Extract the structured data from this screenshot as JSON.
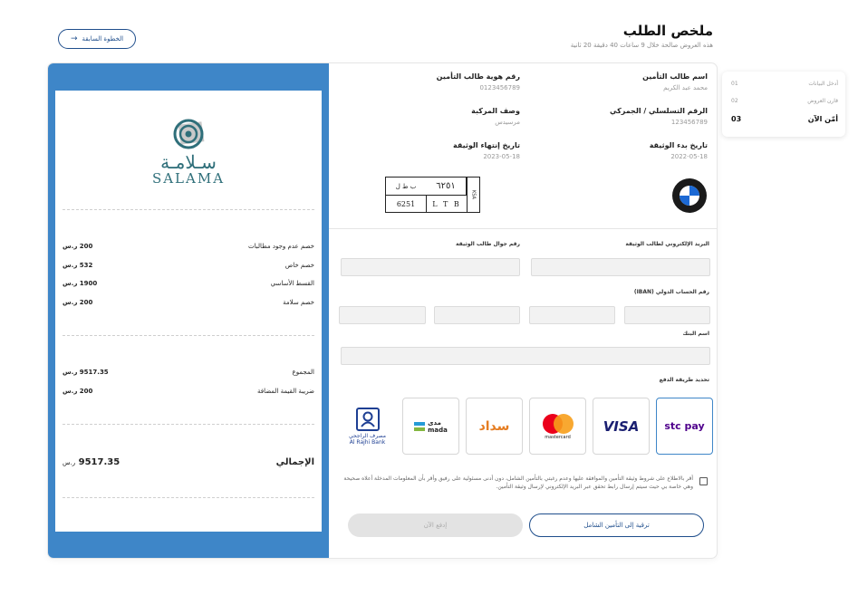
{
  "header": {
    "title": "ملخص الطلب",
    "subtitle": "هذه العروض صالحة خلال 9 ساعات 40 دقيقة 20 ثانية",
    "back_label": "الخطوة السابقة"
  },
  "steps": [
    {
      "num": "01",
      "label": "أدخل البيانات"
    },
    {
      "num": "02",
      "label": "قارن العروض"
    },
    {
      "num": "03",
      "label": "أمّن الآن"
    }
  ],
  "receipt": {
    "logo_arabic": "سـلامـة",
    "logo_english": "SALAMA",
    "rows1": [
      {
        "label": "خصم عدم وجود مطالبات",
        "value": "200 ر.س"
      },
      {
        "label": "خصم خاص",
        "value": "532 ر.س"
      },
      {
        "label": "القسط الأساسي",
        "value": "1900 ر.س"
      },
      {
        "label": "خصم سلامة",
        "value": "200 ر.س"
      }
    ],
    "rows2": [
      {
        "label": "المجموع",
        "value": "9517.35 ر.س"
      },
      {
        "label": "ضريبة القيمة المضافة",
        "value": "200 ر.س"
      }
    ],
    "total": {
      "label": "الإجمالي",
      "value": "9517.35",
      "currency": "ر.س"
    }
  },
  "info": {
    "applicant_name_label": "اسم طالب التأمين",
    "applicant_name_value": "محمد عبد الكريم",
    "applicant_id_label": "رقم هوية طالب التأمين",
    "applicant_id_value": "0123456789",
    "serial_label": "الرقم التسلسلي / الجمركي",
    "serial_value": "123456789",
    "vehicle_desc_label": "وصف المركبة",
    "vehicle_desc_value": "مرسيدس",
    "start_date_label": "تاريخ بدء الوثيقة",
    "start_date_value": "2022-05-18",
    "end_date_label": "تاريخ إنتهاء الوثيقة",
    "end_date_value": "2023-05-18",
    "brand_text": "BMW"
  },
  "plate": {
    "ar_num": "٦٢٥١",
    "ar_letters": "ب ط ل",
    "en_num": "6251",
    "en_letters": "L T B",
    "side": "KSA"
  },
  "form": {
    "email_label": "البريد الإلكتروني لطالب الوثيقة",
    "phone_label": "رقم جوال طالب الوثيقة",
    "iban_label": "رقم الحساب الدولي (IBAN)",
    "bank_label": "اسم البنك",
    "payment_label": "تحديد طريقة الدفع"
  },
  "payments": {
    "stcpay": "stc pay",
    "visa": "VISA",
    "mastercard": "mastercard",
    "sadad": "سداد",
    "mada_ar": "مدى",
    "mada_en": "mada",
    "rajhi_ar": "مصرف الراجحي",
    "rajhi_en": "Al Rajhi Bank"
  },
  "terms": "أقر بالاطلاع على شروط وثيقة التأمين والموافقة عليها وعدم رغبتي بالتأمين الشامل، دون أدنى مسئولية على رفيق وأقر بأن المعلومات المدخلة أعلاه صحيحة وهي خاصة بي حيث سيتم إرسال رابط تحقق عبر البريد الإلكتروني لإرسال وثيقة التأمين.",
  "buttons": {
    "upgrade": "ترقية إلى التأمين الشامل",
    "pay_now": "إدفع الآن"
  },
  "colors": {
    "accent": "#3e86c8",
    "navy": "#1f4e8c",
    "logo": "#2f6f7a"
  }
}
